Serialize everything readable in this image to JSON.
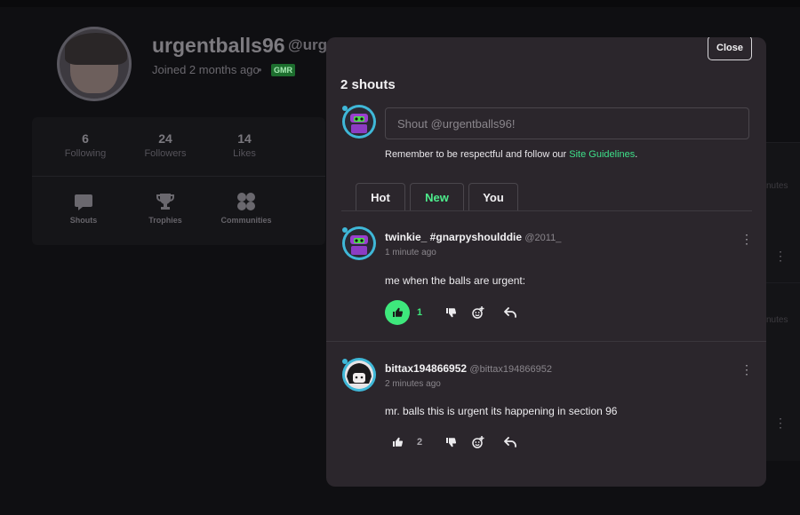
{
  "profile": {
    "username": "urgentballs96",
    "handle": "@urge",
    "joined": "Joined 2 months ago",
    "separator": "•",
    "badge": "GMR",
    "stats": [
      {
        "value": "6",
        "label": "Following"
      },
      {
        "value": "24",
        "label": "Followers"
      },
      {
        "value": "14",
        "label": "Likes"
      }
    ],
    "nav": [
      {
        "label": "Shouts",
        "icon": "speech-bubble-icon"
      },
      {
        "label": "Trophies",
        "icon": "trophy-icon"
      },
      {
        "label": "Communities",
        "icon": "communities-icon"
      }
    ],
    "background_fragments": [
      "nutes",
      "nutes"
    ]
  },
  "modal": {
    "close_label": "Close",
    "count_label": "2 shouts",
    "input_placeholder": "Shout @urgentballs96!",
    "guidelines_prefix": "Remember to be respectful and follow our ",
    "guidelines_link": "Site Guidelines",
    "guidelines_suffix": ".",
    "tabs": [
      {
        "label": "Hot",
        "active": false
      },
      {
        "label": "New",
        "active": true
      },
      {
        "label": "You",
        "active": false
      }
    ],
    "posts": [
      {
        "author": "twinkie_ #gnarpyshoulddie",
        "handle": "@2011_",
        "time": "1 minute ago",
        "body": "me when the balls are urgent:",
        "likes": "1",
        "liked": true
      },
      {
        "author": "bittax194866952",
        "handle": "@bittax194866952",
        "time": "2 minutes ago",
        "body": "mr. balls this is urgent its happening in section 96",
        "likes": "2",
        "liked": false
      }
    ]
  },
  "colors": {
    "accent_green": "#3ee87c",
    "link_green": "#3ee08a",
    "modal_bg": "#2b262c",
    "page_bg": "#0f0f12"
  }
}
